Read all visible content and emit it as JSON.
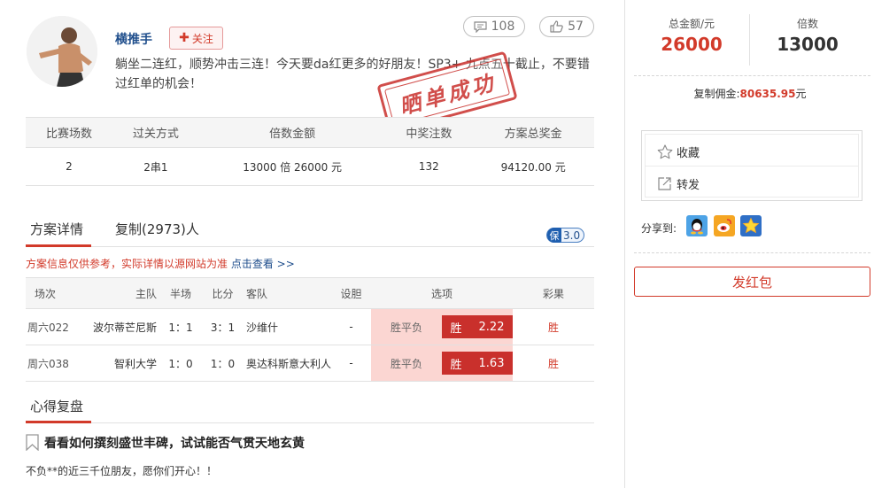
{
  "header": {
    "username": "横推手",
    "follow_label": "关注",
    "comment_count": "108",
    "like_count": "57",
    "description": "躺坐二连红，顺势冲击三连！今天要da红更多的好朋友！SP3+ 九点五十截止，不要错过红单的机会！",
    "stamp_text": "晒单成功"
  },
  "summary": {
    "headers": [
      "比赛场数",
      "过关方式",
      "倍数金额",
      "中奖注数",
      "方案总奖金"
    ],
    "row": {
      "matches": "2",
      "pass_type": "2串1",
      "multiple_amount": "13000 倍  26000 元",
      "win_count": "132",
      "total_prize": "94120.00 元"
    }
  },
  "tabs": {
    "detail": "方案详情",
    "copy": "复制(2973)人",
    "badge_icon": "保",
    "badge_value": "3.0"
  },
  "notice": {
    "text": "方案信息仅供参考，实际详情以源网站为准",
    "link": "点击查看 >>"
  },
  "detail_table": {
    "headers": [
      "场次",
      "主队",
      "半场",
      "比分",
      "客队",
      "设胆",
      "选项",
      "彩果"
    ],
    "rows": [
      {
        "id": "周六022",
        "home": "波尔蒂芒尼斯",
        "half": "1：1",
        "score": "3：1",
        "away": "沙维什",
        "banker": "-",
        "option_label": "胜平负",
        "pick": "胜",
        "odds": "2.22",
        "result": "胜"
      },
      {
        "id": "周六038",
        "home": "智利大学",
        "half": "1：0",
        "score": "1：0",
        "away": "奥达科斯意大利人",
        "banker": "-",
        "option_label": "胜平负",
        "pick": "胜",
        "odds": "1.63",
        "result": "胜"
      }
    ]
  },
  "review": {
    "section_title": "心得复盘",
    "headline": "看看如何撰刻盛世丰碑，试试能否气贯天地玄黄",
    "body": "不负**的近三千位朋友，愿你们开心！！"
  },
  "sidebar": {
    "total_label": "总金额/元",
    "total_value": "26000",
    "multiple_label": "倍数",
    "multiple_value": "13000",
    "commission_label": "复制佣金:",
    "commission_value": "80635.95",
    "commission_unit": "元",
    "favorite_label": "收藏",
    "forward_label": "转发",
    "share_label": "分享到:",
    "red_packet_label": "发红包"
  },
  "colors": {
    "accent": "#d23a2a",
    "link": "#1f4e8c",
    "option_bg": "#fbd6d2"
  }
}
